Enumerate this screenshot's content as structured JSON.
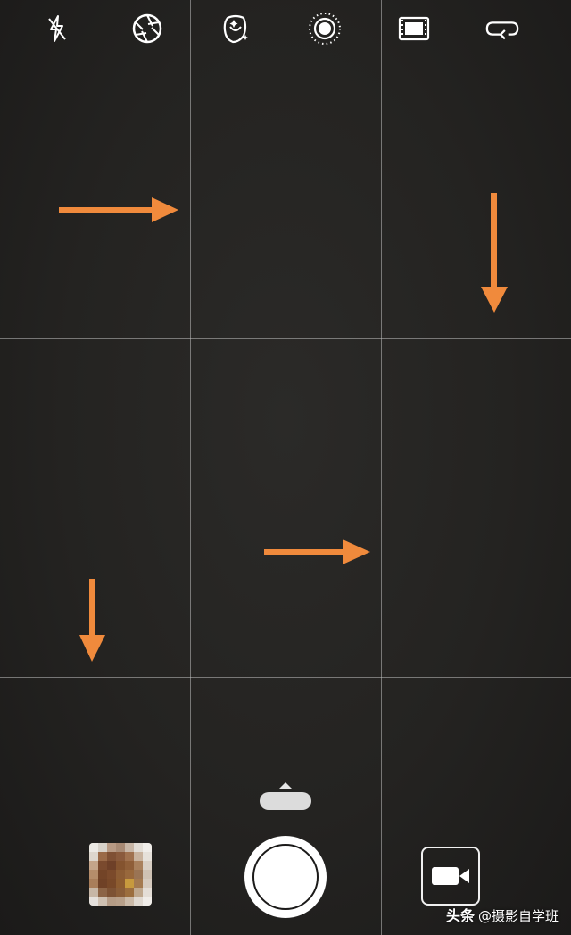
{
  "camera": {
    "top_controls": [
      {
        "name": "flash-off-icon",
        "icon": "flash-off"
      },
      {
        "name": "aperture-icon",
        "icon": "aperture"
      },
      {
        "name": "beauty-icon",
        "icon": "face-sparkle"
      },
      {
        "name": "live-photo-icon",
        "icon": "live-circle"
      },
      {
        "name": "filmstrip-icon",
        "icon": "filmstrip"
      },
      {
        "name": "loop-icon",
        "icon": "loop-arrow"
      }
    ],
    "grid": {
      "columns": 3,
      "rows": 3
    },
    "bottom_controls": {
      "gallery_thumbnail": "thumbnail",
      "shutter": "shutter-button",
      "video_mode": "video-camera-icon"
    }
  },
  "annotations": {
    "arrow_color": "#f08a3c",
    "arrows": [
      {
        "direction": "right"
      },
      {
        "direction": "down"
      },
      {
        "direction": "down"
      },
      {
        "direction": "right"
      }
    ]
  },
  "watermark": {
    "brand": "头条",
    "handle": "@摄影自学班"
  },
  "colors": {
    "background": "#242321",
    "grid_line": "#bebebe",
    "icon": "#ffffff"
  }
}
